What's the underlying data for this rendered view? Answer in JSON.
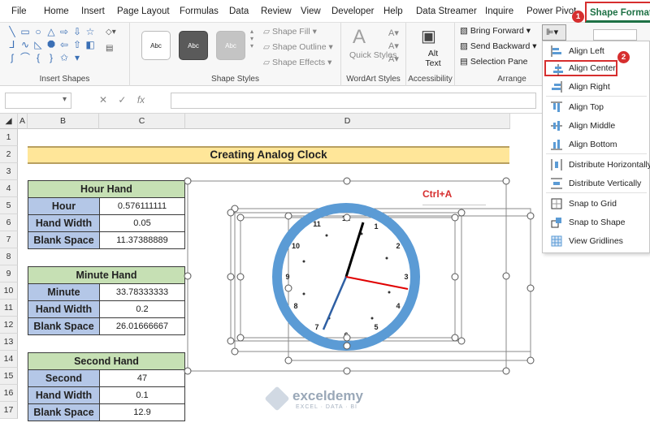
{
  "tabs": [
    "File",
    "Home",
    "Insert",
    "Page Layout",
    "Formulas",
    "Data",
    "Review",
    "View",
    "Developer",
    "Help",
    "Data Streamer",
    "Inquire",
    "Power Pivot",
    "Shape Format"
  ],
  "ribbon": {
    "groups": {
      "insert_shapes": "Insert Shapes",
      "shape_styles": "Shape Styles",
      "wordart_styles": "WordArt Styles",
      "accessibility": "Accessibility",
      "arrange": "Arrange"
    },
    "style_sample": "Abc",
    "shape_fill": "Shape Fill",
    "shape_outline": "Shape Outline",
    "shape_effects": "Shape Effects",
    "quick_styles": "Quick Styles",
    "alt_text": "Alt Text",
    "bring_forward": "Bring Forward",
    "send_backward": "Send Backward",
    "selection_pane": "Selection Pane"
  },
  "formula_bar": {
    "fx": "fx",
    "value": ""
  },
  "columns": [
    "A",
    "B",
    "C",
    "D"
  ],
  "rows": [
    "1",
    "2",
    "3",
    "4",
    "5",
    "6",
    "7",
    "8",
    "9",
    "10",
    "11",
    "12",
    "13",
    "14",
    "15",
    "16",
    "17"
  ],
  "sheet": {
    "title": "Creating Analog Clock",
    "hour_hand": {
      "header": "Hour Hand",
      "rows": [
        {
          "label": "Hour",
          "value": "0.576111111"
        },
        {
          "label": "Hand Width",
          "value": "0.05"
        },
        {
          "label": "Blank Space",
          "value": "11.37388889"
        }
      ]
    },
    "minute_hand": {
      "header": "Minute Hand",
      "rows": [
        {
          "label": "Minute",
          "value": "33.78333333"
        },
        {
          "label": "Hand Width",
          "value": "0.2"
        },
        {
          "label": "Blank Space",
          "value": "26.01666667"
        }
      ]
    },
    "second_hand": {
      "header": "Second Hand",
      "rows": [
        {
          "label": "Second",
          "value": "47"
        },
        {
          "label": "Hand Width",
          "value": "0.1"
        },
        {
          "label": "Blank Space",
          "value": "12.9"
        }
      ]
    },
    "annotation": "Ctrl+A"
  },
  "clock": {
    "numbers": [
      "12",
      "1",
      "2",
      "3",
      "4",
      "5",
      "6",
      "7",
      "8",
      "9",
      "10",
      "11"
    ],
    "ring_color": "#5b9bd5",
    "hour_hand_color": "#000000",
    "minute_hand_color": "#2e5fa3",
    "second_hand_color": "#e00000"
  },
  "align_menu": {
    "items": [
      {
        "label": "Align Left",
        "icon": "align-left-icon"
      },
      {
        "label": "Align Center",
        "icon": "align-center-icon"
      },
      {
        "label": "Align Right",
        "icon": "align-right-icon"
      },
      {
        "label": "Align Top",
        "icon": "align-top-icon"
      },
      {
        "label": "Align Middle",
        "icon": "align-middle-icon"
      },
      {
        "label": "Align Bottom",
        "icon": "align-bottom-icon"
      },
      {
        "label": "Distribute Horizontally",
        "icon": "distribute-horizontal-icon"
      },
      {
        "label": "Distribute Vertically",
        "icon": "distribute-vertical-icon"
      },
      {
        "label": "Snap to Grid",
        "icon": "snap-grid-icon"
      },
      {
        "label": "Snap to Shape",
        "icon": "snap-shape-icon"
      },
      {
        "label": "View Gridlines",
        "icon": "gridlines-icon"
      }
    ],
    "highlighted": "Align Center"
  },
  "callouts": [
    "1",
    "2"
  ],
  "watermark": {
    "name": "exceldemy",
    "tagline": "EXCEL · DATA · BI"
  },
  "colors": {
    "accent_red": "#d62e2e",
    "excel_green": "#1e7145",
    "title_fill": "#ffe699",
    "header_fill": "#c6e0b4",
    "label_fill": "#b4c7e7"
  }
}
